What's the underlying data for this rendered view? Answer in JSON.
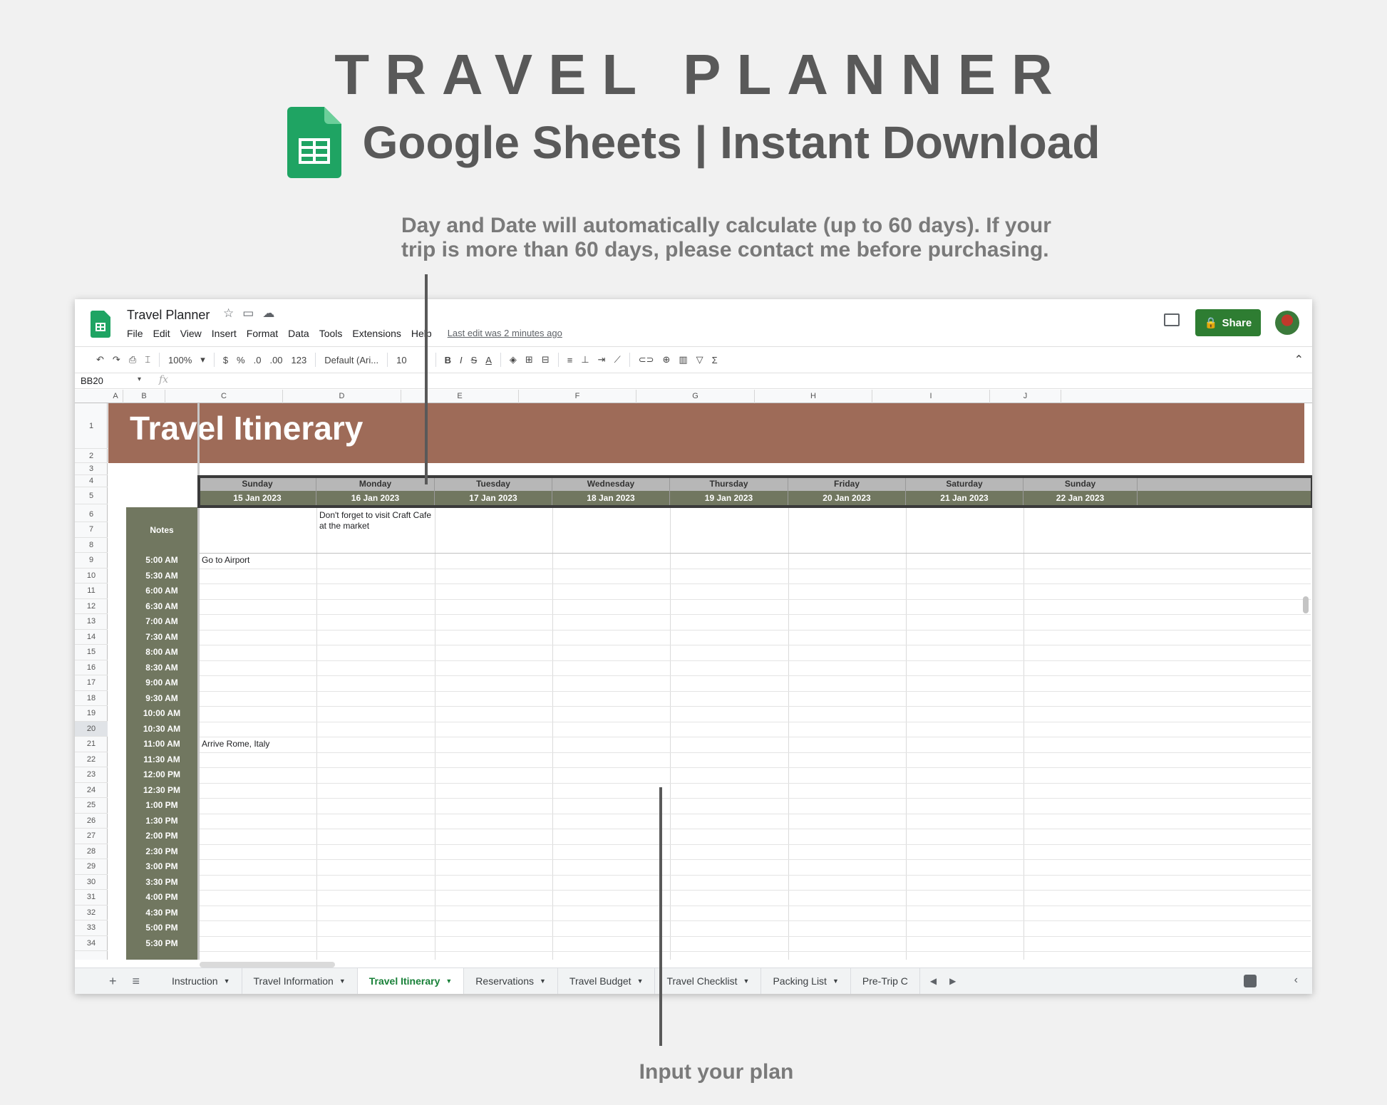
{
  "promo": {
    "title": "TRAVEL PLANNER",
    "subtitle": "Google Sheets | Instant Download",
    "note_top": "Day and Date will automatically calculate (up to 60 days). If your trip is more than 60 days, please contact me before purchasing.",
    "note_bottom": "Input your plan"
  },
  "app": {
    "doc_title": "Travel Planner",
    "menu": [
      "File",
      "Edit",
      "View",
      "Insert",
      "Format",
      "Data",
      "Tools",
      "Extensions",
      "Help"
    ],
    "last_edit": "Last edit was 2 minutes ago",
    "share_label": "Share",
    "accent_color": "#2e7d32"
  },
  "toolbar": {
    "zoom": "100%",
    "currency": "$",
    "percent": "%",
    "dec_less": ".0",
    "dec_more": ".00",
    "format_more": "123",
    "font": "Default (Ari...",
    "font_size": "10",
    "bold": "B",
    "italic": "I",
    "strike": "S",
    "text_color": "A"
  },
  "formula_bar": {
    "cell_ref": "BB20",
    "fx": "fx"
  },
  "grid": {
    "columns": [
      "A",
      "B",
      "C",
      "D",
      "E",
      "F",
      "G",
      "H",
      "I",
      "J"
    ],
    "rows": [
      "1",
      "2",
      "3",
      "4",
      "5",
      "6",
      "7",
      "8",
      "9",
      "10",
      "11",
      "12",
      "13",
      "14",
      "15",
      "16",
      "17",
      "18",
      "19",
      "20",
      "21",
      "22",
      "23",
      "24",
      "25",
      "26",
      "27",
      "28",
      "29",
      "30",
      "31",
      "32",
      "33",
      "34"
    ],
    "selected_row": "20"
  },
  "sheet": {
    "banner_title": "Travel Itinerary",
    "banner_color": "#9e6b58",
    "days": [
      "Sunday",
      "Monday",
      "Tuesday",
      "Wednesday",
      "Thursday",
      "Friday",
      "Saturday",
      "Sunday"
    ],
    "dates": [
      "15 Jan 2023",
      "16 Jan 2023",
      "17 Jan 2023",
      "18 Jan 2023",
      "19 Jan 2023",
      "20 Jan 2023",
      "21 Jan 2023",
      "22 Jan 2023"
    ],
    "notes_label": "Notes",
    "notes": [
      "",
      "Don't forget to visit Craft Cafe at the market",
      "",
      "",
      "",
      "",
      "",
      ""
    ],
    "times": [
      "5:00 AM",
      "5:30 AM",
      "6:00 AM",
      "6:30 AM",
      "7:00 AM",
      "7:30 AM",
      "8:00 AM",
      "8:30 AM",
      "9:00 AM",
      "9:30 AM",
      "10:00 AM",
      "10:30 AM",
      "11:00 AM",
      "11:30 AM",
      "12:00 PM",
      "12:30 PM",
      "1:00 PM",
      "1:30 PM",
      "2:00 PM",
      "2:30 PM",
      "3:00 PM",
      "3:30 PM",
      "4:00 PM",
      "4:30 PM",
      "5:00 PM",
      "5:30 PM"
    ],
    "entries": [
      {
        "time": "5:00 AM",
        "day": "Sunday",
        "text": "Go to Airport"
      },
      {
        "time": "11:00 AM",
        "day": "Sunday",
        "text": "Arrive Rome, Italy"
      }
    ],
    "header_color": "#717760"
  },
  "tabs": {
    "items": [
      "Instruction",
      "Travel Information",
      "Travel Itinerary",
      "Reservations",
      "Travel Budget",
      "Travel Checklist",
      "Packing List",
      "Pre-Trip C"
    ],
    "active": "Travel Itinerary"
  }
}
